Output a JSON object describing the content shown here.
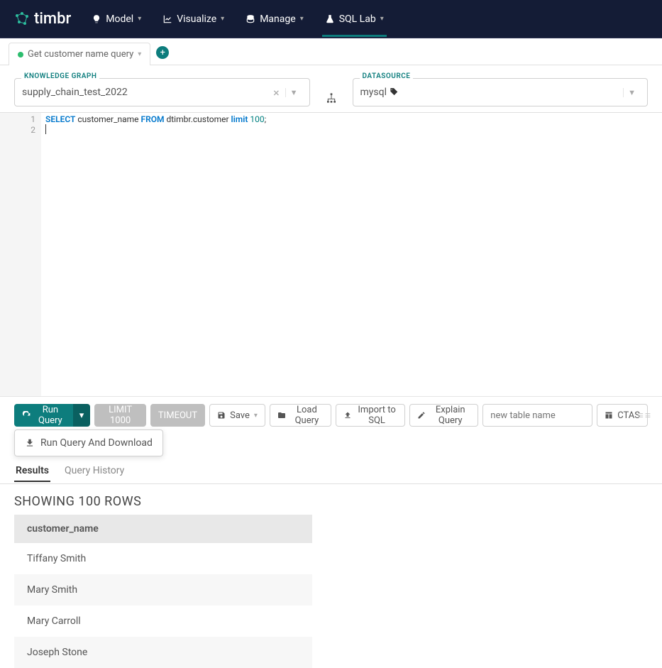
{
  "brand": "timbr",
  "nav": [
    {
      "label": "Model"
    },
    {
      "label": "Visualize"
    },
    {
      "label": "Manage"
    },
    {
      "label": "SQL Lab",
      "active": true
    }
  ],
  "tab": {
    "label": "Get customer name query"
  },
  "knowledgeGraph": {
    "label": "KNOWLEDGE GRAPH",
    "value": "supply_chain_test_2022"
  },
  "datasource": {
    "label": "DATASOURCE",
    "value": "mysql"
  },
  "sql": {
    "line1_kw1": "SELECT",
    "line1_mid": " customer_name ",
    "line1_kw2": "FROM",
    "line1_mid2": " dtimbr.customer ",
    "line1_kw3": "limit",
    "line1_sp": " ",
    "line1_num": "100",
    "line1_end": ";"
  },
  "gutter": [
    "1",
    "2"
  ],
  "toolbar": {
    "run": "Run Query",
    "limit": "LIMIT 1000",
    "timeout": "TIMEOUT",
    "save": "Save",
    "load": "Load Query",
    "import": "Import to SQL",
    "explain": "Explain Query",
    "placeholder": "new table name",
    "ctas": "CTAS",
    "runDownload": "Run Query And Download"
  },
  "resultTabs": {
    "results": "Results",
    "history": "Query History"
  },
  "showing": "SHOWING 100 ROWS",
  "columnHeader": "customer_name",
  "rows": [
    "Tiffany Smith",
    "Mary Smith",
    "Mary Carroll",
    "Joseph Stone"
  ]
}
